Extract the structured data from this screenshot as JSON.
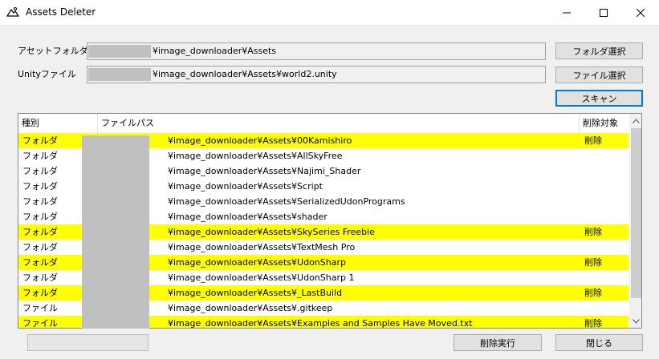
{
  "window": {
    "title": "Assets Deleter"
  },
  "form": {
    "asset_folder_label": "アセットフォルダ",
    "asset_folder_value": "¥image_downloader¥Assets",
    "unity_file_label": "Unityファイル",
    "unity_file_value": "¥image_downloader¥Assets¥world2.unity",
    "folder_select_button": "フォルダ選択",
    "file_select_button": "ファイル選択",
    "scan_button": "スキャン"
  },
  "table": {
    "columns": [
      "種別",
      "ファイルパス",
      "削除対象"
    ],
    "rows": [
      {
        "kind": "フォルダ",
        "path": "¥image_downloader¥Assets¥00Kamishiro",
        "delete": "削除"
      },
      {
        "kind": "フォルダ",
        "path": "¥image_downloader¥Assets¥AllSkyFree",
        "delete": ""
      },
      {
        "kind": "フォルダ",
        "path": "¥image_downloader¥Assets¥Najimi_Shader",
        "delete": ""
      },
      {
        "kind": "フォルダ",
        "path": "¥image_downloader¥Assets¥Script",
        "delete": ""
      },
      {
        "kind": "フォルダ",
        "path": "¥image_downloader¥Assets¥SerializedUdonPrograms",
        "delete": ""
      },
      {
        "kind": "フォルダ",
        "path": "¥image_downloader¥Assets¥shader",
        "delete": ""
      },
      {
        "kind": "フォルダ",
        "path": "¥image_downloader¥Assets¥SkySeries Freebie",
        "delete": "削除"
      },
      {
        "kind": "フォルダ",
        "path": "¥image_downloader¥Assets¥TextMesh Pro",
        "delete": ""
      },
      {
        "kind": "フォルダ",
        "path": "¥image_downloader¥Assets¥UdonSharp",
        "delete": "削除"
      },
      {
        "kind": "フォルダ",
        "path": "¥image_downloader¥Assets¥UdonSharp 1",
        "delete": ""
      },
      {
        "kind": "フォルダ",
        "path": "¥image_downloader¥Assets¥_LastBuild",
        "delete": "削除"
      },
      {
        "kind": "ファイル",
        "path": "¥image_downloader¥Assets¥.gitkeep",
        "delete": ""
      },
      {
        "kind": "ファイル",
        "path": "¥image_downloader¥Assets¥Examples and Samples Have Moved.txt",
        "delete": "削除"
      }
    ]
  },
  "footer": {
    "delete_button": "削除実行",
    "close_button": "閉じる"
  },
  "colors": {
    "highlight": "#ffff00",
    "accent": "#0078d7"
  }
}
